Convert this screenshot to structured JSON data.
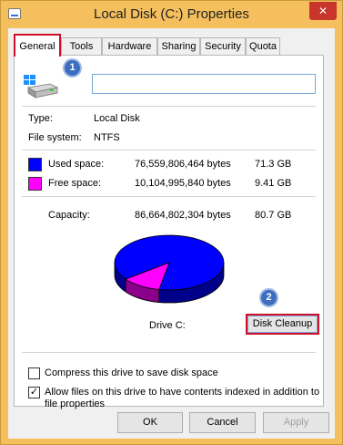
{
  "window": {
    "title": "Local Disk (C:) Properties",
    "close_glyph": "✕"
  },
  "tabs": [
    {
      "label": "General",
      "active": true
    },
    {
      "label": "Tools"
    },
    {
      "label": "Hardware"
    },
    {
      "label": "Sharing"
    },
    {
      "label": "Security"
    },
    {
      "label": "Quota"
    }
  ],
  "badges": {
    "one": "1",
    "two": "2"
  },
  "general": {
    "drive_icon": "drive-icon",
    "name_value": "",
    "type_label": "Type:",
    "type_value": "Local Disk",
    "fs_label": "File system:",
    "fs_value": "NTFS",
    "used": {
      "label": "Used space:",
      "bytes": "76,559,806,464 bytes",
      "size": "71.3 GB",
      "color": "#0000ff"
    },
    "free": {
      "label": "Free space:",
      "bytes": "10,104,995,840 bytes",
      "size": "9.41 GB",
      "color": "#ff00ff"
    },
    "capacity": {
      "label": "Capacity:",
      "bytes": "86,664,802,304 bytes",
      "size": "80.7 GB"
    },
    "drive_label": "Drive C:",
    "cleanup_button": "Disk Cleanup",
    "compress": {
      "label": "Compress this drive to save disk space",
      "checked": false
    },
    "index": {
      "label_line1": "Allow files on this drive to have contents indexed in addition to",
      "label_line2": "file properties",
      "checked": true
    }
  },
  "pie": {
    "used_fraction": 0.883,
    "used_color": "#0000ff",
    "free_color": "#ff00ff"
  },
  "buttons": {
    "ok": "OK",
    "cancel": "Cancel",
    "apply": "Apply"
  }
}
